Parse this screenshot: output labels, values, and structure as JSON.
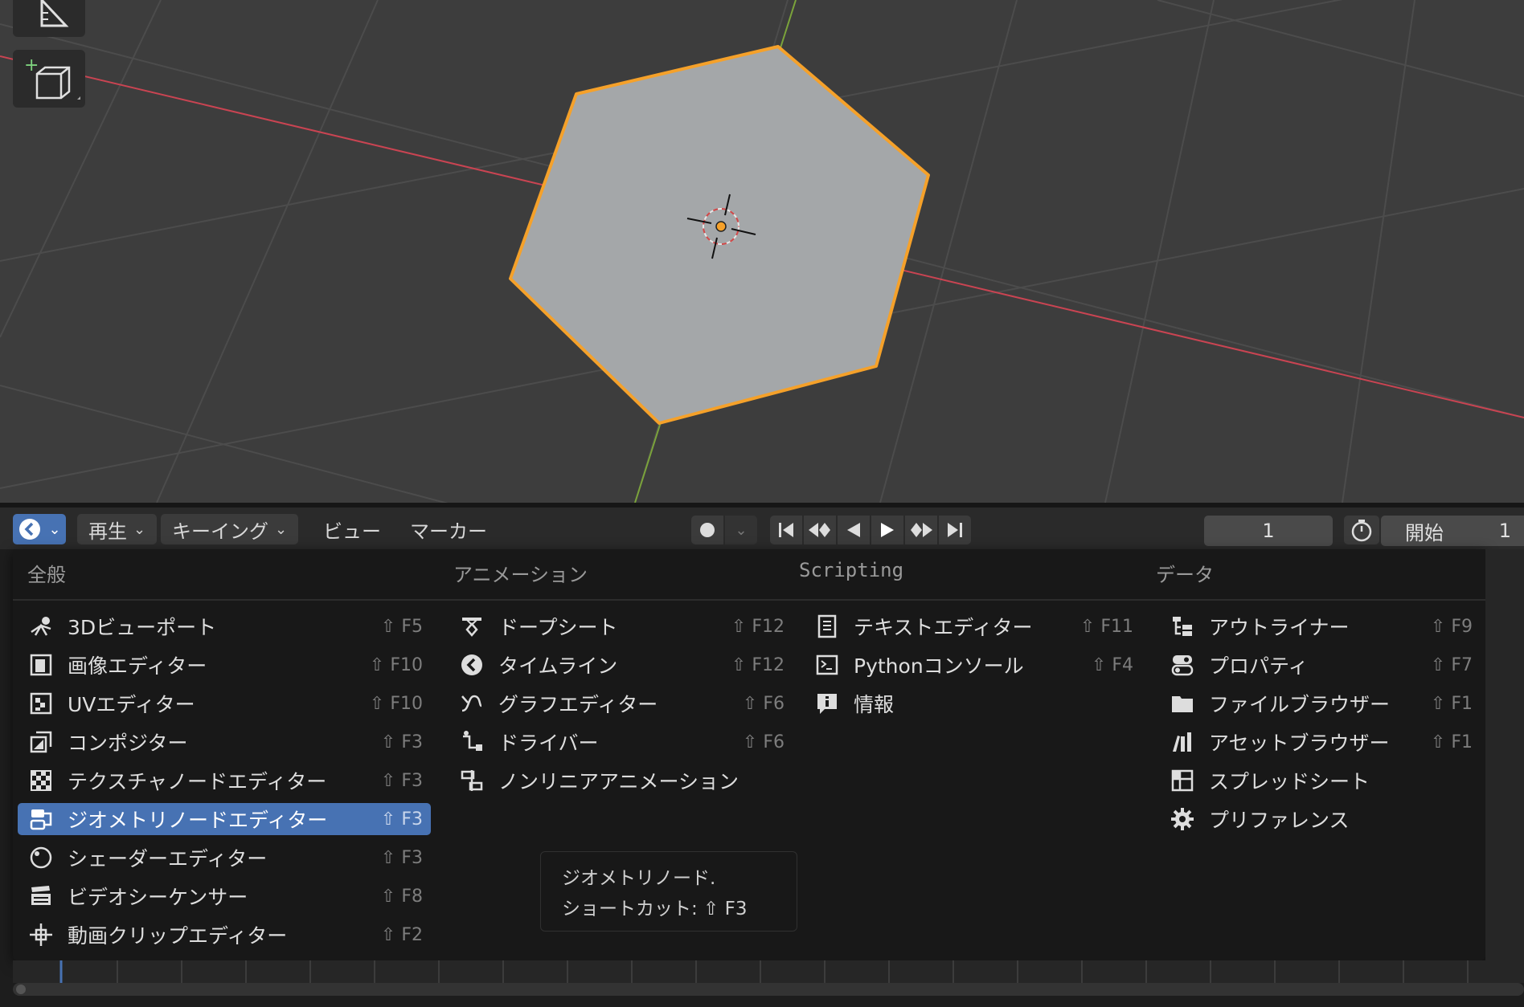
{
  "timeline": {
    "menus": [
      "再生",
      "キーイング",
      "ビュー",
      "マーカー"
    ],
    "current_frame": "1",
    "start_label": "開始",
    "start_value": "1"
  },
  "editor_menu": {
    "columns": [
      {
        "heading": "全般",
        "items": [
          {
            "label": "3Dビューポート",
            "shortcut": "⇧ F5",
            "icon": "viewport-3d-icon"
          },
          {
            "label": "画像エディター",
            "shortcut": "⇧ F10",
            "icon": "image-editor-icon"
          },
          {
            "label": "UVエディター",
            "shortcut": "⇧ F10",
            "icon": "uv-editor-icon"
          },
          {
            "label": "コンポジター",
            "shortcut": "⇧ F3",
            "icon": "compositor-icon"
          },
          {
            "label": "テクスチャノードエディター",
            "shortcut": "⇧ F3",
            "icon": "texture-node-icon"
          },
          {
            "label": "ジオメトリノードエディター",
            "shortcut": "⇧ F3",
            "icon": "geometry-node-icon",
            "selected": true
          },
          {
            "label": "シェーダーエディター",
            "shortcut": "⇧ F3",
            "icon": "shader-editor-icon"
          },
          {
            "label": "ビデオシーケンサー",
            "shortcut": "⇧ F8",
            "icon": "video-sequencer-icon"
          },
          {
            "label": "動画クリップエディター",
            "shortcut": "⇧ F2",
            "icon": "movie-clip-icon"
          }
        ]
      },
      {
        "heading": "アニメーション",
        "items": [
          {
            "label": "ドープシート",
            "shortcut": "⇧ F12",
            "icon": "dopesheet-icon"
          },
          {
            "label": "タイムライン",
            "shortcut": "⇧ F12",
            "icon": "timeline-icon"
          },
          {
            "label": "グラフエディター",
            "shortcut": "⇧ F6",
            "icon": "graph-editor-icon"
          },
          {
            "label": "ドライバー",
            "shortcut": "⇧ F6",
            "icon": "drivers-icon"
          },
          {
            "label": "ノンリニアアニメーション",
            "shortcut": "",
            "icon": "nla-icon"
          }
        ]
      },
      {
        "heading": "Scripting",
        "items": [
          {
            "label": "テキストエディター",
            "shortcut": "⇧ F11",
            "icon": "text-editor-icon"
          },
          {
            "label": "Pythonコンソール",
            "shortcut": "⇧ F4",
            "icon": "python-console-icon"
          },
          {
            "label": "情報",
            "shortcut": "",
            "icon": "info-icon"
          }
        ]
      },
      {
        "heading": "データ",
        "items": [
          {
            "label": "アウトライナー",
            "shortcut": "⇧ F9",
            "icon": "outliner-icon"
          },
          {
            "label": "プロパティ",
            "shortcut": "⇧ F7",
            "icon": "properties-icon"
          },
          {
            "label": "ファイルブラウザー",
            "shortcut": "⇧ F1",
            "icon": "file-browser-icon"
          },
          {
            "label": "アセットブラウザー",
            "shortcut": "⇧ F1",
            "icon": "asset-browser-icon"
          },
          {
            "label": "スプレッドシート",
            "shortcut": "",
            "icon": "spreadsheet-icon"
          },
          {
            "label": "プリファレンス",
            "shortcut": "",
            "icon": "preferences-icon"
          }
        ]
      }
    ]
  },
  "tooltip": {
    "line1": "ジオメトリノード.",
    "line2": "ショートカット: ⇧ F3"
  },
  "colors": {
    "viewport_bg": "#3d3d3d",
    "selection_outline": "#f5a12a",
    "x_axis": "#c94452",
    "y_axis": "#7ba33b",
    "menu_highlight": "#4772b3"
  }
}
